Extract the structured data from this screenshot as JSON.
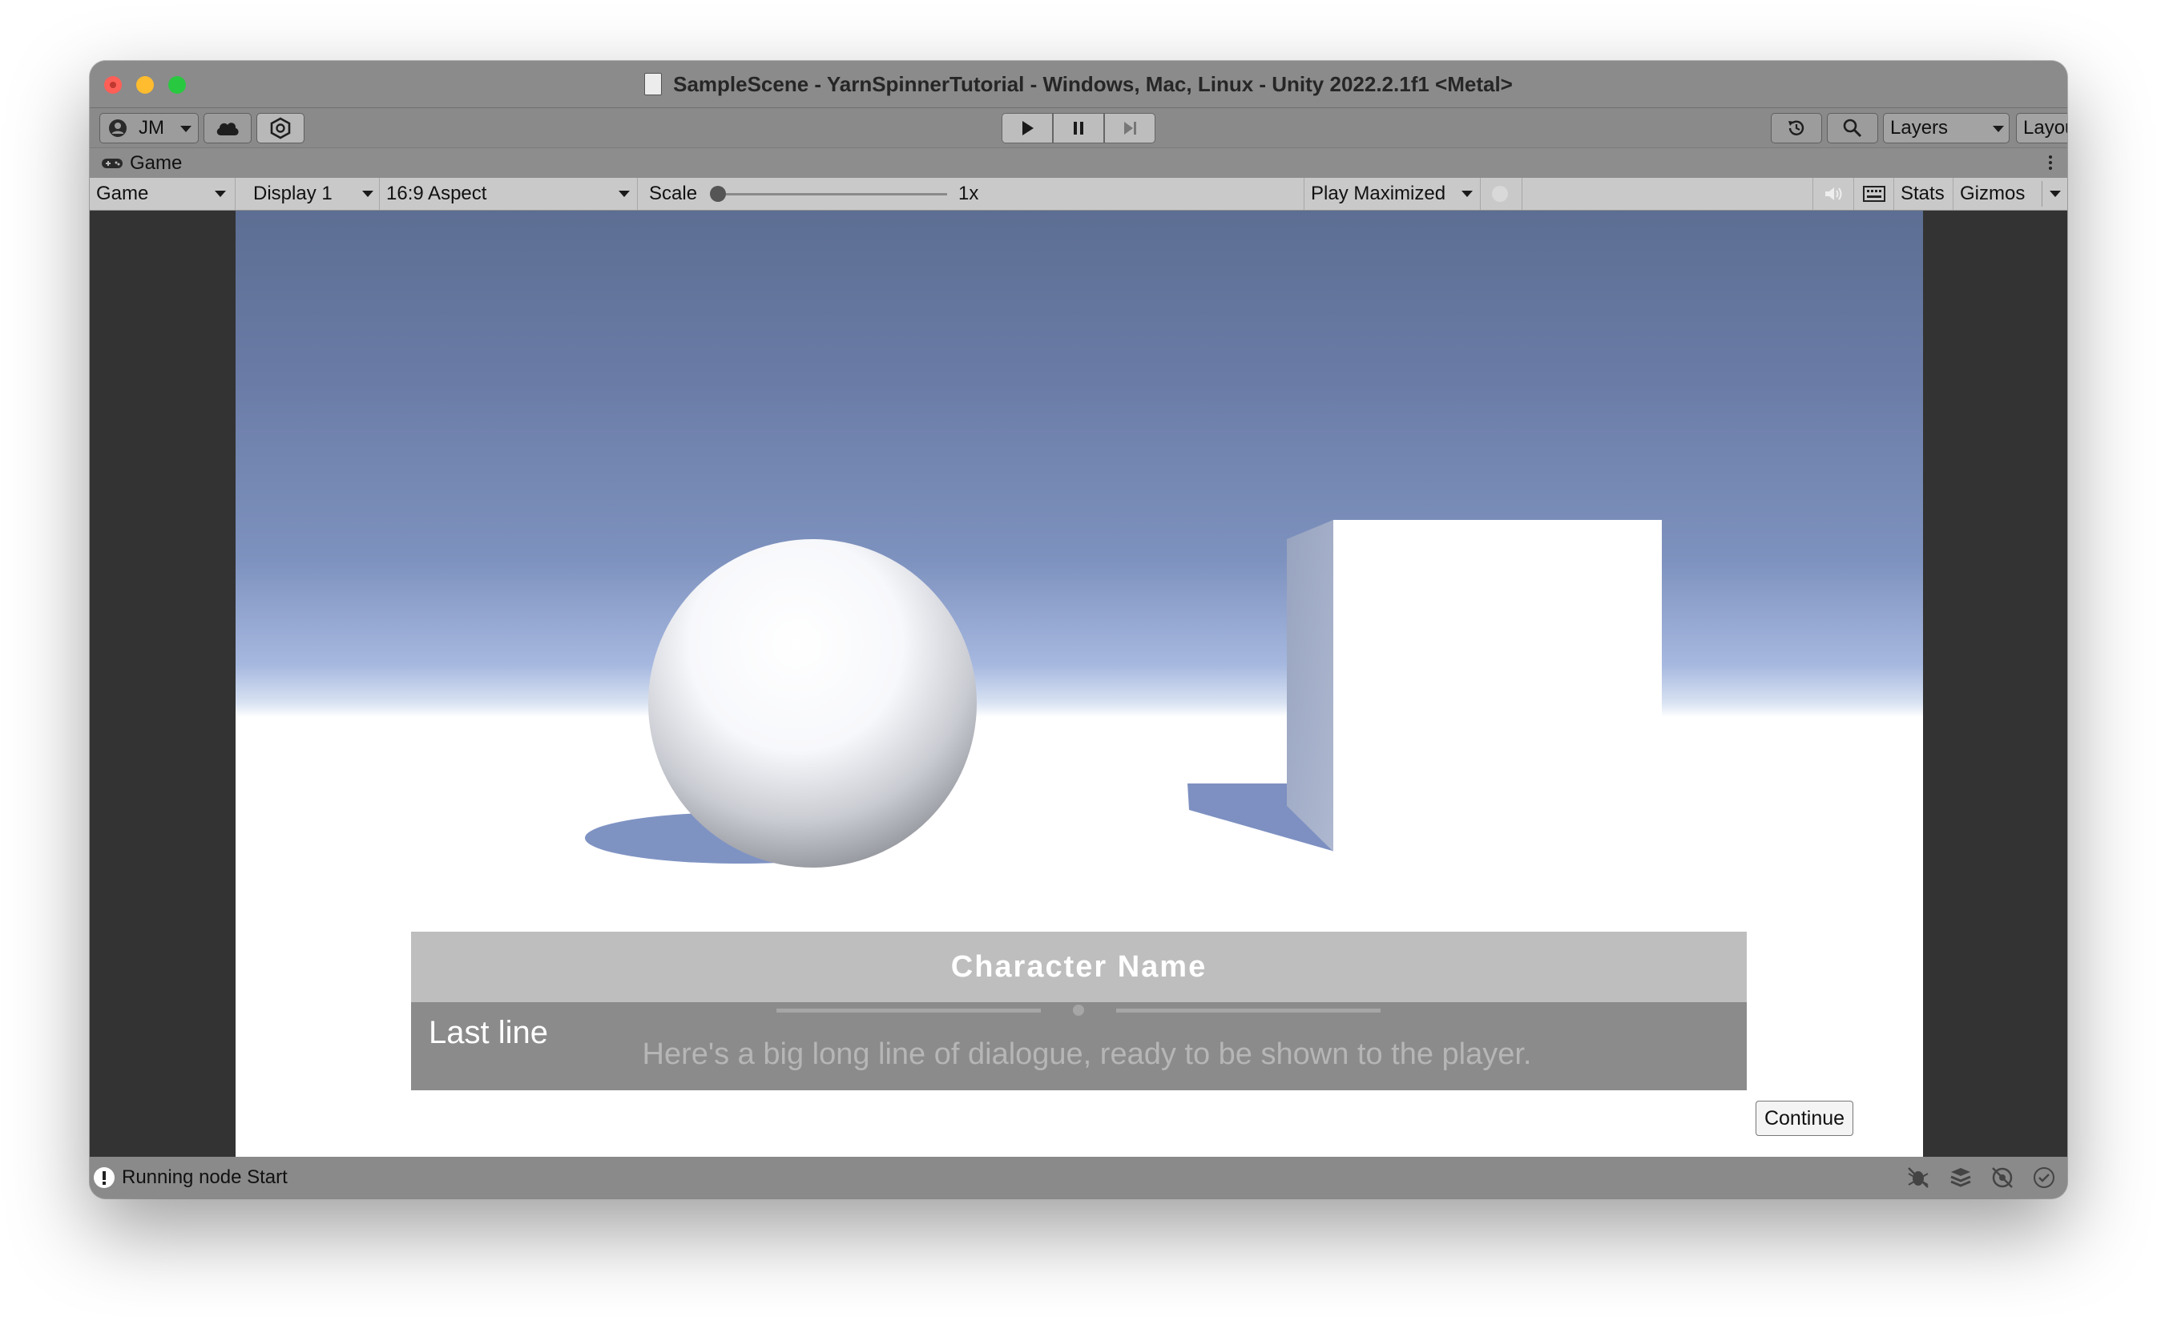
{
  "window": {
    "title": "SampleScene - YarnSpinnerTutorial - Windows, Mac, Linux - Unity 2022.2.1f1 <Metal>"
  },
  "toolbar": {
    "account_label": "JM",
    "layers_label": "Layers",
    "layout_label": "Layout"
  },
  "tab": {
    "label": "Game"
  },
  "game_bar": {
    "view_select": "Game",
    "display_select": "Display 1",
    "aspect_select": "16:9 Aspect",
    "scale_label": "Scale",
    "scale_value": "1x",
    "play_mode_select": "Play Maximized",
    "stats_label": "Stats",
    "gizmos_label": "Gizmos"
  },
  "dialogue": {
    "character_name": "Character Name",
    "last_line_label": "Last line",
    "line_text": "Here's a big long line of dialogue, ready to be shown to the player.",
    "continue_label": "Continue"
  },
  "status": {
    "message": "Running node Start"
  },
  "icons": {
    "account": "account-icon",
    "cloud": "cloud-icon",
    "collab": "collab-icon",
    "play": "play-icon",
    "pause": "pause-icon",
    "step": "step-icon",
    "history": "history-icon",
    "search": "search-icon",
    "gamepad": "gamepad-icon",
    "mute": "mute-audio-icon",
    "keyboard": "keyboard-icon",
    "warning": "warning-icon"
  },
  "colors": {
    "sky_top": "#5d6e93",
    "sky_horizon": "#a6b8df",
    "ground": "#ffffff",
    "dialogue_name_bg": "#bebebe",
    "dialogue_body_bg": "#8b8b8b"
  }
}
